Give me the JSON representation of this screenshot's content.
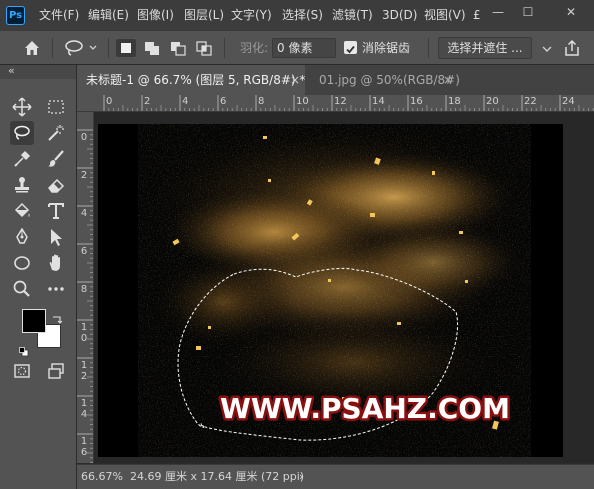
{
  "app_logo": "Ps",
  "menu": {
    "items": [
      "文件(F)",
      "编辑(E)",
      "图像(I)",
      "图层(L)",
      "文字(Y)",
      "选择(S)",
      "滤镜(T)",
      "3D(D)",
      "视图(V)"
    ],
    "overflow": "£"
  },
  "window_controls": {
    "minimize": "—",
    "maximize": "☐",
    "close": "✕"
  },
  "options_bar": {
    "feather_label": "羽化:",
    "feather_value": "0 像素",
    "antialias_label": "消除锯齿",
    "antialias_checked": true,
    "select_mask_label": "选择并遮住 ..."
  },
  "tabs": [
    {
      "title": "未标题-1 @ 66.7% (图层 5, RGB/8#) *",
      "active": true,
      "close": "×"
    },
    {
      "title": "01.jpg @ 50%(RGB/8#)",
      "active": false,
      "close": "×"
    }
  ],
  "ruler_h": [
    "0",
    "2",
    "4",
    "6",
    "8",
    "10",
    "12",
    "14",
    "16",
    "18",
    "20",
    "22",
    "24"
  ],
  "ruler_v": [
    "0",
    "2",
    "4",
    "6",
    "8",
    "10",
    "12",
    "14",
    "16"
  ],
  "canvas": {
    "watermark": "WWW.PSAHZ.COM"
  },
  "status": {
    "zoom": "66.67%",
    "doc_info": "24.69 厘米 x 17.64 厘米 (72 ppi)",
    "arrow": "›"
  },
  "colors": {
    "foreground": "#000000",
    "background": "#ffffff",
    "accent": "#31a8ff",
    "gold": "#c8963c",
    "watermark_fill": "#ffffff",
    "watermark_stroke": "#8a1010"
  },
  "icons": {
    "home": "home-icon",
    "lasso": "lasso-icon",
    "move": "move-icon",
    "marquee": "marquee-icon",
    "magic_wand": "magic-wand-icon",
    "eyedropper": "eyedropper-icon",
    "brush": "brush-icon",
    "stamp": "clone-stamp-icon",
    "eraser": "eraser-icon",
    "fill": "paint-bucket-icon",
    "type": "type-icon",
    "pen": "pen-icon",
    "path_select": "path-select-icon",
    "ellipse": "ellipse-icon",
    "hand": "hand-icon",
    "zoom": "zoom-icon",
    "more": "more-icon",
    "quick_mask": "quick-mask-icon",
    "screen_mode": "screen-mode-icon",
    "share": "share-icon"
  }
}
